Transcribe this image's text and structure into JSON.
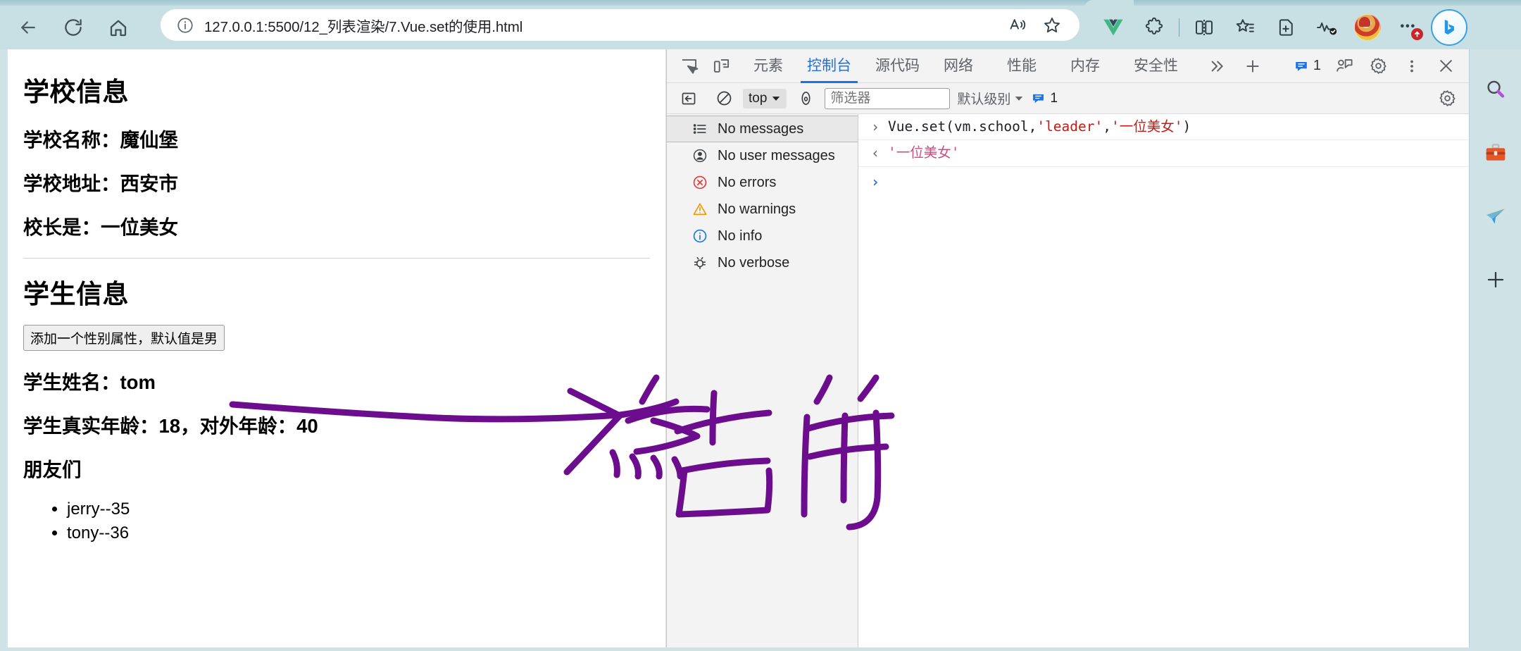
{
  "browser": {
    "url": "127.0.0.1:5500/12_列表渲染/7.Vue.set的使用.html",
    "nav": {
      "back": "back-arrow",
      "reload": "reload",
      "home": "home"
    },
    "url_icons": {
      "info": "info-circle",
      "read_aloud": "read-aloud",
      "favorite": "star"
    },
    "toolbar_icons": [
      "vue-devtools-icon",
      "extensions-icon",
      "split-screen-icon",
      "collections-icon",
      "add-tab-icon",
      "browser-essentials-icon",
      "profile-avatar",
      "settings-more-icon",
      "bing-chat-icon"
    ],
    "sidebar_icons": [
      "search-icon",
      "tools-briefcase-icon",
      "paper-plane-icon",
      "add-icon"
    ]
  },
  "page": {
    "school_heading": "学校信息",
    "school_name": "学校名称：魔仙堡",
    "school_address": "学校地址：西安市",
    "school_leader": "校长是：一位美女",
    "student_heading": "学生信息",
    "add_gender_button": "添加一个性别属性，默认值是男",
    "student_name": "学生姓名：tom",
    "student_age": "学生真实年龄：18，对外年龄：40",
    "friends_heading": "朋友们",
    "friends": [
      "jerry--35",
      "tony--36"
    ]
  },
  "annotation": {
    "text": "点击前",
    "color": "#6C0D8E"
  },
  "devtools": {
    "inspect_icon": "inspect-element-icon",
    "device_icon": "device-toolbar-icon",
    "tabs": [
      {
        "label": "元素",
        "active": false
      },
      {
        "label": "控制台",
        "active": true
      },
      {
        "label": "源代码",
        "active": false
      },
      {
        "label": "网络",
        "active": false
      },
      {
        "label": "性能",
        "active": false
      },
      {
        "label": "内存",
        "active": false
      },
      {
        "label": "安全性",
        "active": false
      }
    ],
    "more_tabs_icon": "chevron-double-right-icon",
    "add_tab_icon": "plus-icon",
    "message_count": "1",
    "right_icons": [
      "feedback-icon",
      "gear-icon",
      "kebab-menu-icon",
      "close-icon"
    ],
    "console_toolbar": {
      "sidebar_toggle_icon": "console-sidebar-toggle-icon",
      "clear_icon": "clear-console-icon",
      "context": "top",
      "eye_icon": "live-expression-icon",
      "filter_placeholder": "筛选器",
      "filter_value": "",
      "level": "默认级别",
      "badge_count": "1",
      "settings_icon": "gear-icon"
    },
    "sidebar_items": [
      {
        "icon": "list-icon",
        "label": "No messages",
        "selected": true
      },
      {
        "icon": "user-icon",
        "label": "No user messages",
        "selected": false
      },
      {
        "icon": "error-icon",
        "label": "No errors",
        "selected": false
      },
      {
        "icon": "warning-icon",
        "label": "No warnings",
        "selected": false
      },
      {
        "icon": "info-icon",
        "label": "No info",
        "selected": false
      },
      {
        "icon": "verbose-icon",
        "label": "No verbose",
        "selected": false
      }
    ],
    "console": {
      "input_parts": {
        "fn": "Vue.set(vm.school,",
        "arg1": "'leader'",
        "comma": ",",
        "arg2": "'一位美女'",
        "close": ")"
      },
      "output": "'一位美女'"
    },
    "colors": {
      "accent": "#1a73e8",
      "string": "#c41a16",
      "output": "#c5517f"
    }
  }
}
